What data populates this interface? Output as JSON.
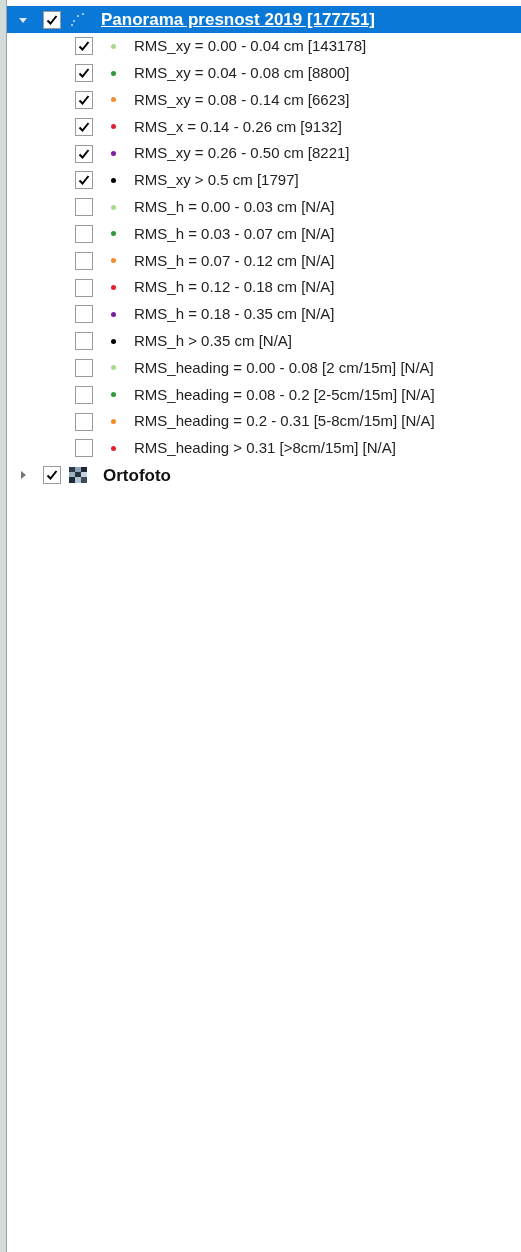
{
  "layers": [
    {
      "name": "Panorama presnost 2019 [177751]",
      "kind": "points",
      "expanded": true,
      "checked": true,
      "selected": true,
      "children": [
        {
          "label": "RMS_xy = 0.00 - 0.04 cm [143178]",
          "checked": true,
          "color": "#a8d98a"
        },
        {
          "label": "RMS_xy = 0.04 - 0.08 cm [8800]",
          "checked": true,
          "color": "#2e9a3c"
        },
        {
          "label": "RMS_xy = 0.08 - 0.14 cm [6623]",
          "checked": true,
          "color": "#f28c28"
        },
        {
          "label": "RMS_x = 0.14 - 0.26 cm [9132]",
          "checked": true,
          "color": "#e0202e"
        },
        {
          "label": "RMS_xy = 0.26 - 0.50 cm [8221]",
          "checked": true,
          "color": "#7b1fa2"
        },
        {
          "label": "RMS_xy > 0.5 cm [1797]",
          "checked": true,
          "color": "#000000"
        },
        {
          "label": "RMS_h = 0.00 - 0.03 cm [N/A]",
          "checked": false,
          "color": "#a8d98a"
        },
        {
          "label": "RMS_h = 0.03 - 0.07 cm [N/A]",
          "checked": false,
          "color": "#2e9a3c"
        },
        {
          "label": "RMS_h = 0.07 - 0.12 cm [N/A]",
          "checked": false,
          "color": "#f28c28"
        },
        {
          "label": "RMS_h = 0.12 - 0.18 cm [N/A]",
          "checked": false,
          "color": "#e0202e"
        },
        {
          "label": "RMS_h = 0.18 - 0.35 cm [N/A]",
          "checked": false,
          "color": "#7b1fa2"
        },
        {
          "label": "RMS_h > 0.35 cm [N/A]",
          "checked": false,
          "color": "#000000"
        },
        {
          "label": "RMS_heading = 0.00 - 0.08 [2 cm/15m] [N/A]",
          "checked": false,
          "color": "#a8d98a"
        },
        {
          "label": "RMS_heading = 0.08 - 0.2 [2-5cm/15m] [N/A]",
          "checked": false,
          "color": "#2e9a3c"
        },
        {
          "label": "RMS_heading = 0.2 - 0.31 [5-8cm/15m] [N/A]",
          "checked": false,
          "color": "#f28c28"
        },
        {
          "label": "RMS_heading > 0.31 [>8cm/15m] [N/A]",
          "checked": false,
          "color": "#e0202e"
        }
      ]
    },
    {
      "name": "Ortofoto",
      "kind": "raster",
      "expanded": false,
      "checked": true,
      "selected": false
    }
  ]
}
